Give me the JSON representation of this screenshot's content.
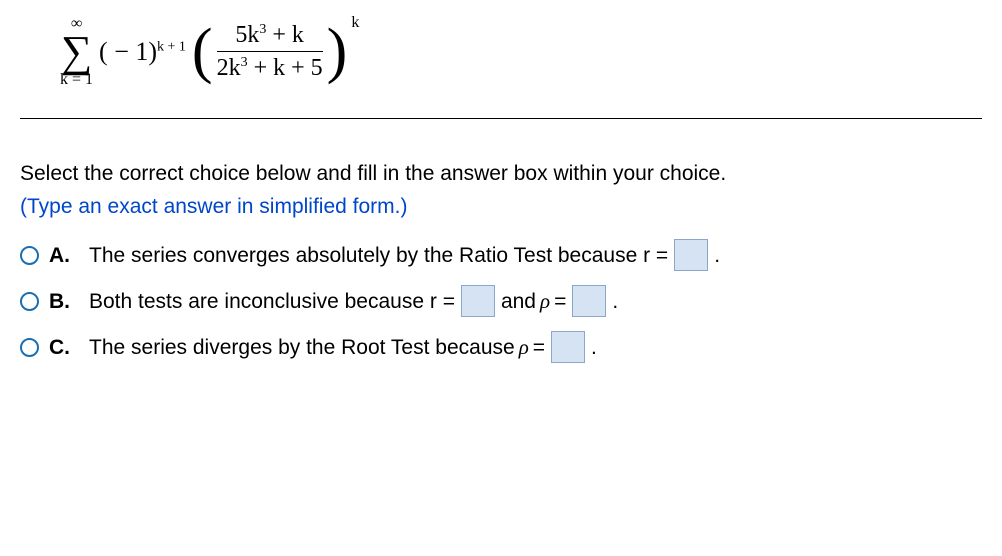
{
  "formula": {
    "sigma_top": "∞",
    "sigma_bottom": "k = 1",
    "term1_base": "( − 1)",
    "term1_exp": "k + 1",
    "frac_num_a": "5k",
    "frac_num_exp": "3",
    "frac_num_b": " + k",
    "frac_den_a": "2k",
    "frac_den_exp": "3",
    "frac_den_b": " + k + 5",
    "outer_exp": "k"
  },
  "instruction": "Select the correct choice below and fill in the answer box within your choice.",
  "sub_instruction": "(Type an exact answer in simplified form.)",
  "choices": {
    "a": {
      "label": "A.",
      "pre": "The series converges absolutely by the Ratio Test because r =",
      "post": "."
    },
    "b": {
      "label": "B.",
      "pre": "Both tests are inconclusive because r =",
      "mid": " and ",
      "rho": "ρ",
      "eq": " =",
      "post": "."
    },
    "c": {
      "label": "C.",
      "pre": "The series diverges by the Root Test because ",
      "rho": "ρ",
      "eq": " =",
      "post": "."
    }
  }
}
